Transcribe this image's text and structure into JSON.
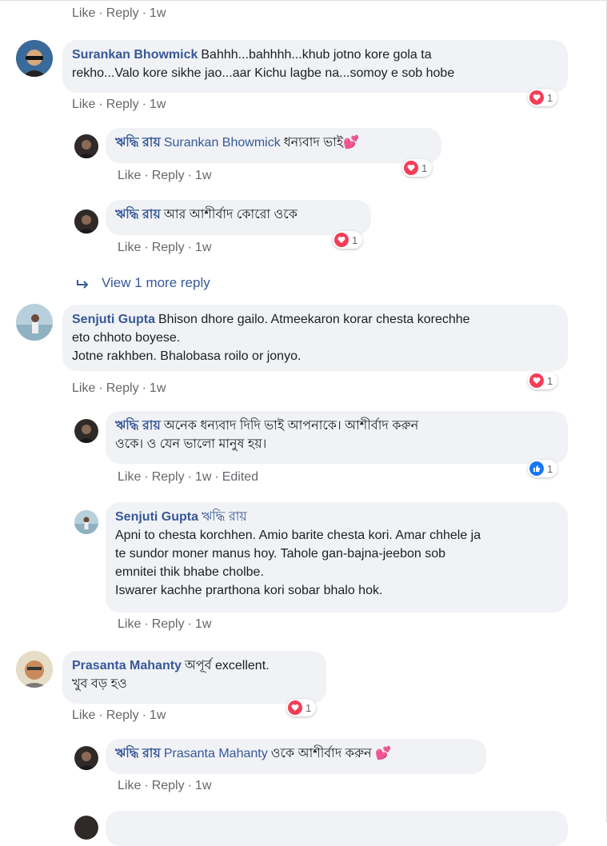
{
  "actions": {
    "like": "Like",
    "reply": "Reply",
    "dot": "·",
    "time": "1w",
    "edited": "Edited"
  },
  "view_more": {
    "label": "View 1 more reply"
  },
  "comments": [
    {
      "name": "Surankan Bhowmick",
      "lines": [
        "Bahhh...bahhhh...khub jotno kore gola ta",
        "rekho...Valo kore sikhe jao...aar Kichu lagbe na...somoy e sob hobe"
      ],
      "reaction": "1"
    },
    {
      "name": "ঋদ্ধি রায়",
      "tag": "Surankan Bhowmick",
      "text": "ধন্যবাদ ভাই",
      "reaction": "1"
    },
    {
      "name": "ঋদ্ধি রায়",
      "text": "আর আশীর্বাদ কোরো ওকে",
      "reaction": "1"
    },
    {
      "name": "Senjuti Gupta",
      "lines": [
        "Bhison dhore gailo. Atmeekaron korar chesta korechhe",
        "eto chhoto boyese.",
        "Jotne rakhben. Bhalobasa roilo or jonyo."
      ],
      "reaction": "1"
    },
    {
      "name": "ঋদ্ধি রায়",
      "lines": [
        "অনেক ধন্যবাদ দিদি ভাই আপনাকে। আশীর্বাদ করুন",
        "ওকে। ও যেন ভালো মানুষ হয়।"
      ],
      "reaction": "1"
    },
    {
      "name": "Senjuti Gupta",
      "tag": "ঋদ্ধি রায়",
      "lines": [
        "Apni to chesta korchhen. Amio barite chesta kori. Amar chhele ja",
        "te sundor moner manus hoy. Tahole gan-bajna-jeebon sob",
        "emnitei thik bhabe cholbe.",
        "Iswarer kachhe prarthona kori sobar bhalo hok."
      ]
    },
    {
      "name": "Prasanta Mahanty",
      "lines": [
        "অপূর্ব excellent.",
        "খুব বড় হও"
      ],
      "reaction": "1"
    },
    {
      "name": "ঋদ্ধি রায়",
      "tag": "Prasanta Mahanty",
      "text": "ওকে আশীর্বাদ করুন",
      "reaction": ""
    }
  ]
}
